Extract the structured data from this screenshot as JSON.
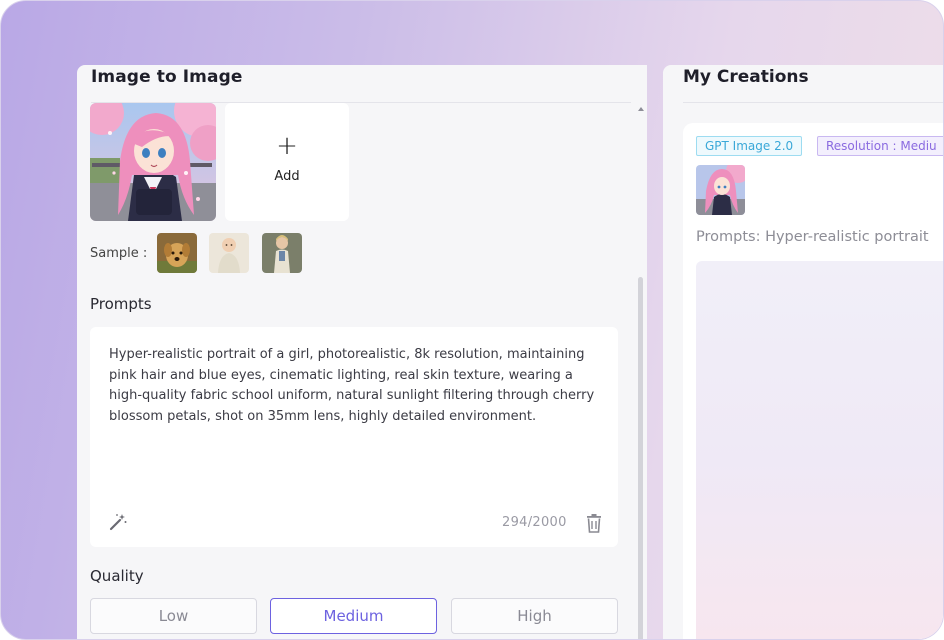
{
  "left_panel": {
    "title": "Image to Image",
    "add_label": "Add",
    "add_symbol": "+",
    "sample_label": "Sample :",
    "samples": [
      "sample-dog-icon",
      "sample-baby-icon",
      "sample-woman-icon"
    ],
    "prompts_label": "Prompts",
    "prompt_text": "Hyper-realistic portrait of a girl, photorealistic, 8k resolution, maintaining pink hair and blue eyes, cinematic lighting, real skin texture, wearing a high-quality fabric school uniform, natural sunlight filtering through cherry blossom petals, shot on 35mm lens, highly detailed environment.",
    "char_count": "294/2000",
    "quality_label": "Quality",
    "quality_options": [
      "Low",
      "Medium",
      "High"
    ],
    "quality_selected": "Medium"
  },
  "right_panel": {
    "title": "My Creations",
    "tags": [
      "GPT Image 2.0",
      "Resolution : Mediu"
    ],
    "prompt_preview": "Prompts: Hyper-realistic portrait"
  },
  "colors": {
    "accent": "#6d62e0",
    "tag_model": "#3aa8d8",
    "tag_resolution": "#8a6ae0"
  }
}
